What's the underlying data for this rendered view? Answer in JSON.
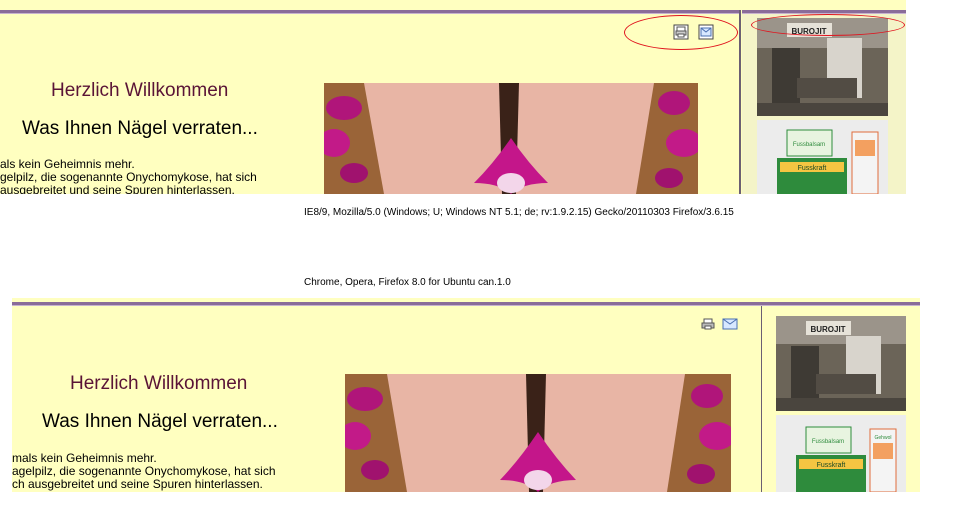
{
  "top_panel": {
    "greeting": "Herzlich Willkommen",
    "heading": "Was Ihnen Nägel verraten...",
    "body_lines": [
      "als kein Geheimnis mehr.",
      "gelpilz, die sogenannte Onychomykose, hat sich",
      "ausgebreitet und seine Spuren hinterlassen."
    ],
    "print_icon": "printer-icon",
    "email_icon": "email-icon"
  },
  "caption_ie": "IE8/9,  Mozilla/5.0 (Windows; U; Windows NT 5.1; de; rv:1.9.2.15) Gecko/20110303 Firefox/3.6.15",
  "caption_chrome": "Chrome, Opera, Firefox 8.0 for Ubuntu can.1.0",
  "bottom_panel": {
    "greeting": "Herzlich Willkommen",
    "heading": "Was Ihnen Nägel verraten...",
    "body_lines": [
      "mals kein Geheimnis mehr.",
      "agelpilz, die sogenannte Onychomykose, hat sich",
      "ch ausgebreitet und seine Spuren hinterlassen."
    ],
    "print_icon": "printer-icon",
    "email_icon": "email-icon"
  },
  "sidebar_photo_text": "BUROJIT",
  "product_box_text": [
    "Fusskraft",
    "Fussbalsam",
    "Gehwol"
  ],
  "colors": {
    "page_bg": "#ffffc0",
    "accent_purple": "#8a6c99",
    "greeting_color": "#5a1436",
    "annotation_red": "#e0141e"
  }
}
